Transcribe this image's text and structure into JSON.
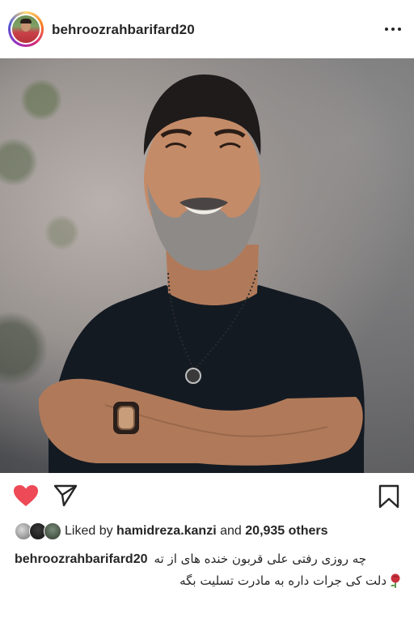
{
  "post": {
    "username": "behroozrahbarifard20",
    "more_icon": "more-horizontal-icon",
    "photo_alt": "portrait photo",
    "liked_by_prefix": "Liked by",
    "liked_by_user": "hamidreza.kanzi",
    "liked_by_and": "and",
    "liked_by_count": "20,935 others",
    "caption_line1": "چه روزی رفتی علی قربون خنده های از ته",
    "caption_line2": "دلت کی جرات داره به مادرت تسلیت بگه",
    "heart_color": "#ed4956",
    "icons": [
      "heart-icon",
      "share-icon",
      "bookmark-icon",
      "rose-emoji-icon"
    ]
  }
}
